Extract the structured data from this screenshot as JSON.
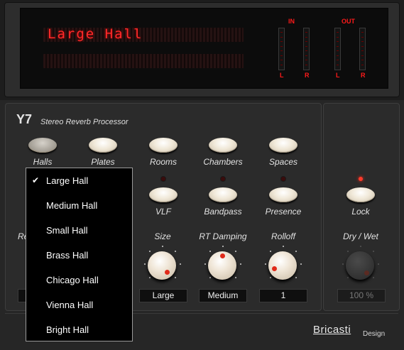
{
  "display": {
    "preset_text": "Large Hall",
    "meters": {
      "in_label": "IN",
      "out_label": "OUT",
      "left": "L",
      "right": "R"
    }
  },
  "header": {
    "model": "Y7",
    "subtitle": "Stereo Reverb Processor"
  },
  "categories": [
    {
      "label": "Halls"
    },
    {
      "label": "Plates"
    },
    {
      "label": "Rooms"
    },
    {
      "label": "Chambers"
    },
    {
      "label": "Spaces"
    }
  ],
  "filters": [
    {
      "label": "VLF"
    },
    {
      "label": "Bandpass"
    },
    {
      "label": "Presence"
    }
  ],
  "knobs": [
    {
      "label": "Size",
      "value": "Large"
    },
    {
      "label": "RT Damping",
      "value": "Medium"
    },
    {
      "label": "Rolloff",
      "value": "1"
    }
  ],
  "partial_label": "Re",
  "side": {
    "lock_label": "Lock",
    "drywet_label": "Dry / Wet",
    "drywet_value": "100 %"
  },
  "brand": {
    "name": "Bricasti",
    "suffix": "Design"
  },
  "dropdown": {
    "selected": "Large Hall",
    "check_glyph": "✔",
    "items": [
      {
        "label": "Large Hall"
      },
      {
        "label": "Medium Hall"
      },
      {
        "label": "Small Hall"
      },
      {
        "label": "Brass Hall"
      },
      {
        "label": "Chicago Hall"
      },
      {
        "label": "Vienna Hall"
      },
      {
        "label": "Bright Hall"
      }
    ]
  },
  "colors": {
    "led_red": "#ff3b2b",
    "lcd_red": "#ff2a2a"
  }
}
